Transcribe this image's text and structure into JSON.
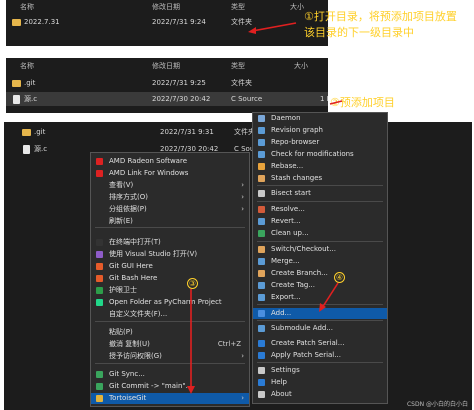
{
  "panel1": {
    "header": {
      "name": "名称",
      "date": "修改日期",
      "type": "类型",
      "size": "大小"
    },
    "rows": [
      {
        "name": "2022.7.31",
        "date": "2022/7/31 9:24",
        "type": "文件夹",
        "size": ""
      }
    ],
    "annotation_line1": "①打开目录，将预添加项目放置",
    "annotation_line2": "该目录的下一级目录中"
  },
  "panel2": {
    "header": {
      "name": "名称",
      "date": "修改日期",
      "type": "类型",
      "size": "大小"
    },
    "rows": [
      {
        "name": ".git",
        "date": "2022/7/31 9:25",
        "type": "文件夹",
        "size": ""
      },
      {
        "name": "源.c",
        "date": "2022/7/30 20:42",
        "type": "C Source",
        "size": "1 KB"
      }
    ],
    "annotation": "②预添加项目"
  },
  "panel3": {
    "rows": [
      {
        "name": ".git",
        "date": "2022/7/31 9:31",
        "type": "文件夹"
      },
      {
        "name": "源.c",
        "date": "2022/7/30 20:42",
        "type": "C Source"
      }
    ]
  },
  "context_menu": {
    "items": [
      {
        "label": "AMD Radeon Software",
        "icon": "amd-icon",
        "arrow": ""
      },
      {
        "label": "AMD Link For Windows",
        "icon": "amd-icon",
        "arrow": ""
      },
      {
        "label": "查看(V)",
        "icon": "",
        "arrow": "›"
      },
      {
        "label": "排序方式(O)",
        "icon": "",
        "arrow": "›"
      },
      {
        "label": "分组依据(P)",
        "icon": "",
        "arrow": "›"
      },
      {
        "label": "刷新(E)",
        "icon": "",
        "arrow": ""
      },
      {
        "label": "在终端中打开(T)",
        "icon": "terminal-icon",
        "arrow": ""
      },
      {
        "label": "使用 Visual Studio 打开(V)",
        "icon": "visual-studio-icon",
        "arrow": ""
      },
      {
        "label": "Git GUI Here",
        "icon": "git-gui-icon",
        "arrow": ""
      },
      {
        "label": "Git Bash Here",
        "icon": "git-bash-icon",
        "arrow": ""
      },
      {
        "label": "护眼卫士",
        "icon": "eye-guard-icon",
        "arrow": ""
      },
      {
        "label": "Open Folder as PyCharm Project",
        "icon": "pycharm-icon",
        "arrow": ""
      },
      {
        "label": "自定义文件夹(F)...",
        "icon": "",
        "arrow": ""
      },
      {
        "label": "粘贴(P)",
        "icon": "",
        "arrow": ""
      },
      {
        "label": "撤消 复制(U)",
        "icon": "",
        "arrow": "",
        "shortcut": "Ctrl+Z"
      },
      {
        "label": "授予访问权限(G)",
        "icon": "",
        "arrow": "›"
      },
      {
        "label": "Git Sync...",
        "icon": "git-sync-icon",
        "arrow": ""
      },
      {
        "label": "Git Commit -> \"main\"...",
        "icon": "git-commit-icon",
        "arrow": ""
      },
      {
        "label": "TortoiseGit",
        "icon": "tortoisegit-icon",
        "arrow": "›"
      }
    ],
    "badge": "③"
  },
  "submenu": {
    "items": [
      {
        "label": "Daemon",
        "icon": "daemon-icon"
      },
      {
        "label": "Revision graph",
        "icon": "revision-graph-icon"
      },
      {
        "label": "Repo-browser",
        "icon": "repo-browser-icon"
      },
      {
        "label": "Check for modifications",
        "icon": "check-modifications-icon"
      },
      {
        "label": "Rebase...",
        "icon": "rebase-icon"
      },
      {
        "label": "Stash changes",
        "icon": "stash-icon"
      },
      {
        "label": "Bisect start",
        "icon": "bisect-icon"
      },
      {
        "label": "Resolve...",
        "icon": "resolve-icon"
      },
      {
        "label": "Revert...",
        "icon": "revert-icon"
      },
      {
        "label": "Clean up...",
        "icon": "cleanup-icon"
      },
      {
        "label": "Switch/Checkout...",
        "icon": "switch-icon"
      },
      {
        "label": "Merge...",
        "icon": "merge-icon"
      },
      {
        "label": "Create Branch...",
        "icon": "branch-icon"
      },
      {
        "label": "Create Tag...",
        "icon": "tag-icon"
      },
      {
        "label": "Export...",
        "icon": "export-icon"
      },
      {
        "label": "Add...",
        "icon": "add-icon"
      },
      {
        "label": "Submodule Add...",
        "icon": "submodule-icon"
      },
      {
        "label": "Create Patch Serial...",
        "icon": "create-patch-icon"
      },
      {
        "label": "Apply Patch Serial...",
        "icon": "apply-patch-icon"
      },
      {
        "label": "Settings",
        "icon": "settings-icon"
      },
      {
        "label": "Help",
        "icon": "help-icon"
      },
      {
        "label": "About",
        "icon": "about-icon"
      }
    ],
    "badge": "④"
  },
  "watermark": "CSDN @小白的白小白",
  "colors": {
    "annotation": "#ffd02a",
    "arrow_red": "#e02020",
    "highlight": "#0f5aa8",
    "panel_bg": "#1c1c1c"
  }
}
